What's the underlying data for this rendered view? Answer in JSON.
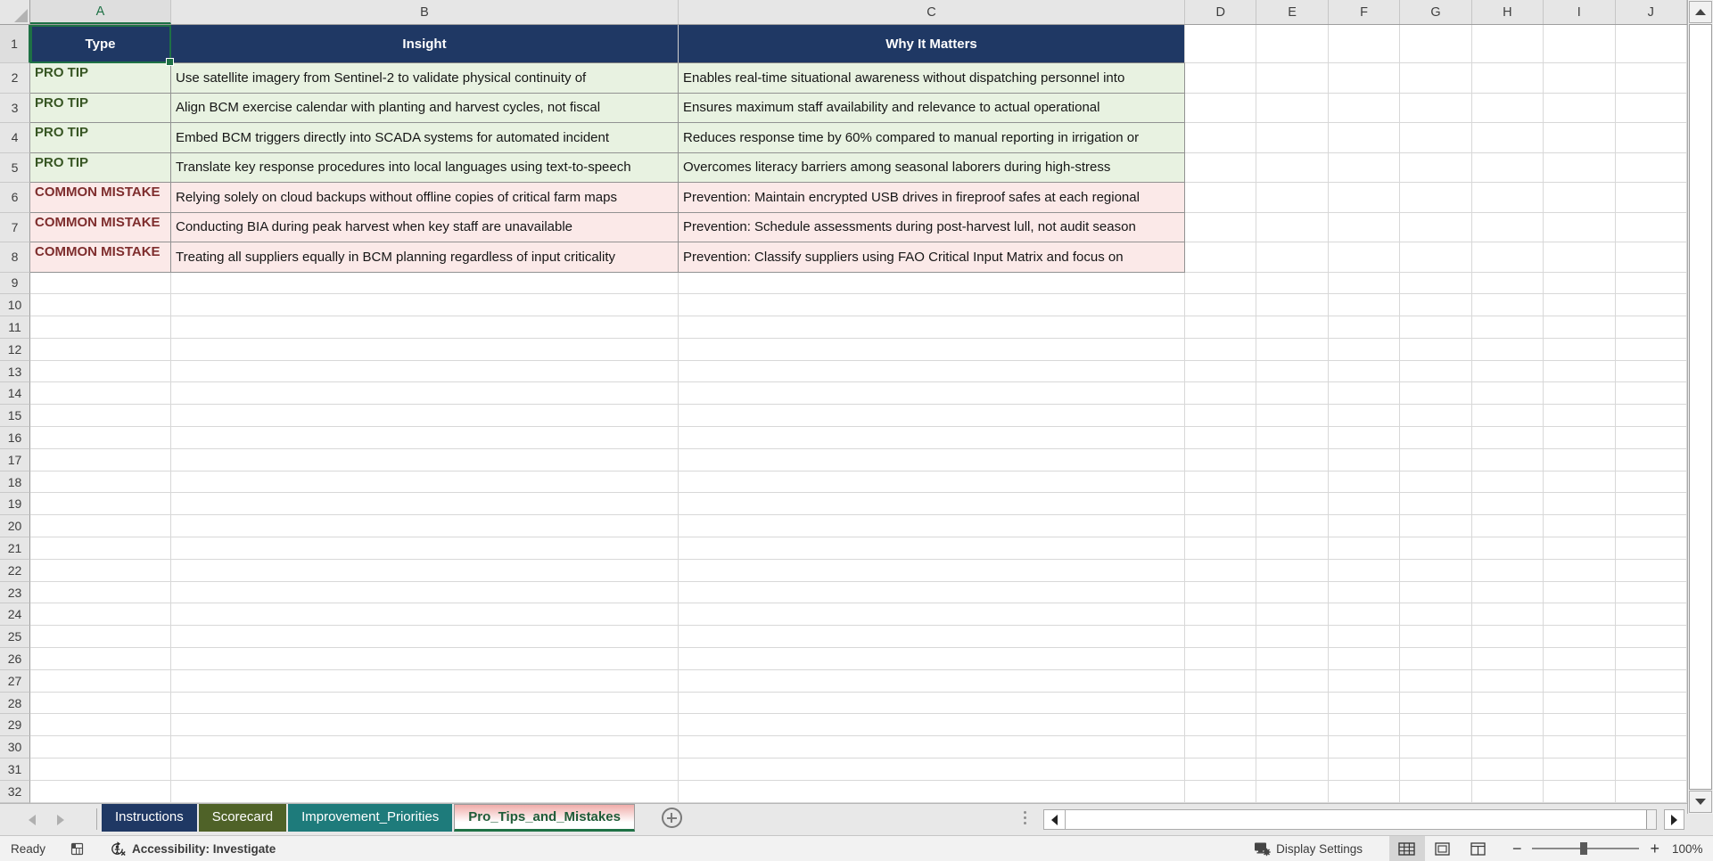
{
  "grid": {
    "columns": [
      "A",
      "B",
      "C",
      "D",
      "E",
      "F",
      "G",
      "H",
      "I",
      "J"
    ],
    "row_count": 32,
    "selected_cell": "A1"
  },
  "table": {
    "headers": {
      "type": "Type",
      "insight": "Insight",
      "why": "Why It Matters"
    },
    "rows": [
      {
        "kind": "tip",
        "type": "PRO TIP",
        "insight": "Use satellite imagery from Sentinel-2 to validate physical continuity of",
        "why": "Enables real-time situational awareness without dispatching personnel into"
      },
      {
        "kind": "tip",
        "type": "PRO TIP",
        "insight": "Align BCM exercise calendar with planting and harvest cycles, not fiscal",
        "why": "Ensures maximum staff availability and relevance to actual operational"
      },
      {
        "kind": "tip",
        "type": "PRO TIP",
        "insight": "Embed BCM triggers directly into SCADA systems for automated incident",
        "why": "Reduces response time by 60% compared to manual reporting in irrigation or"
      },
      {
        "kind": "tip",
        "type": "PRO TIP",
        "insight": "Translate key response procedures into local languages using text-to-speech",
        "why": "Overcomes literacy barriers among seasonal laborers during high-stress"
      },
      {
        "kind": "mistake",
        "type": "COMMON MISTAKE",
        "insight": "Relying solely on cloud backups without offline copies of critical farm maps",
        "why": "Prevention: Maintain encrypted USB drives in fireproof safes at each regional"
      },
      {
        "kind": "mistake",
        "type": "COMMON MISTAKE",
        "insight": "Conducting BIA during peak harvest when key staff are unavailable",
        "why": "Prevention: Schedule assessments during post-harvest lull, not audit season"
      },
      {
        "kind": "mistake",
        "type": "COMMON MISTAKE",
        "insight": "Treating all suppliers equally in BCM planning regardless of input criticality",
        "why": "Prevention: Classify suppliers using FAO Critical Input Matrix and focus on"
      }
    ]
  },
  "sheet_tabs": {
    "tabs": [
      {
        "label": "Instructions",
        "color": "#1F3864",
        "active": false
      },
      {
        "label": "Scorecard",
        "color": "#4F6228",
        "active": false
      },
      {
        "label": "Improvement_Priorities",
        "color": "#1E7B7B",
        "active": false
      },
      {
        "label": "Pro_Tips_and_Mistakes",
        "color": "#F0ACA9",
        "active": true
      }
    ]
  },
  "status_bar": {
    "ready_label": "Ready",
    "accessibility_label": "Accessibility: Investigate",
    "display_settings_label": "Display Settings",
    "zoom_out": "−",
    "zoom_in": "+",
    "zoom_level": "100%"
  },
  "colors": {
    "table_header_bg": "#1F3864",
    "tip_bg": "#E8F2E1",
    "tip_text": "#375623",
    "mistake_bg": "#FBE9E8",
    "mistake_text": "#7E2D2D",
    "accent_green": "#1E7145",
    "chrome_gray": "#E6E6E6"
  }
}
